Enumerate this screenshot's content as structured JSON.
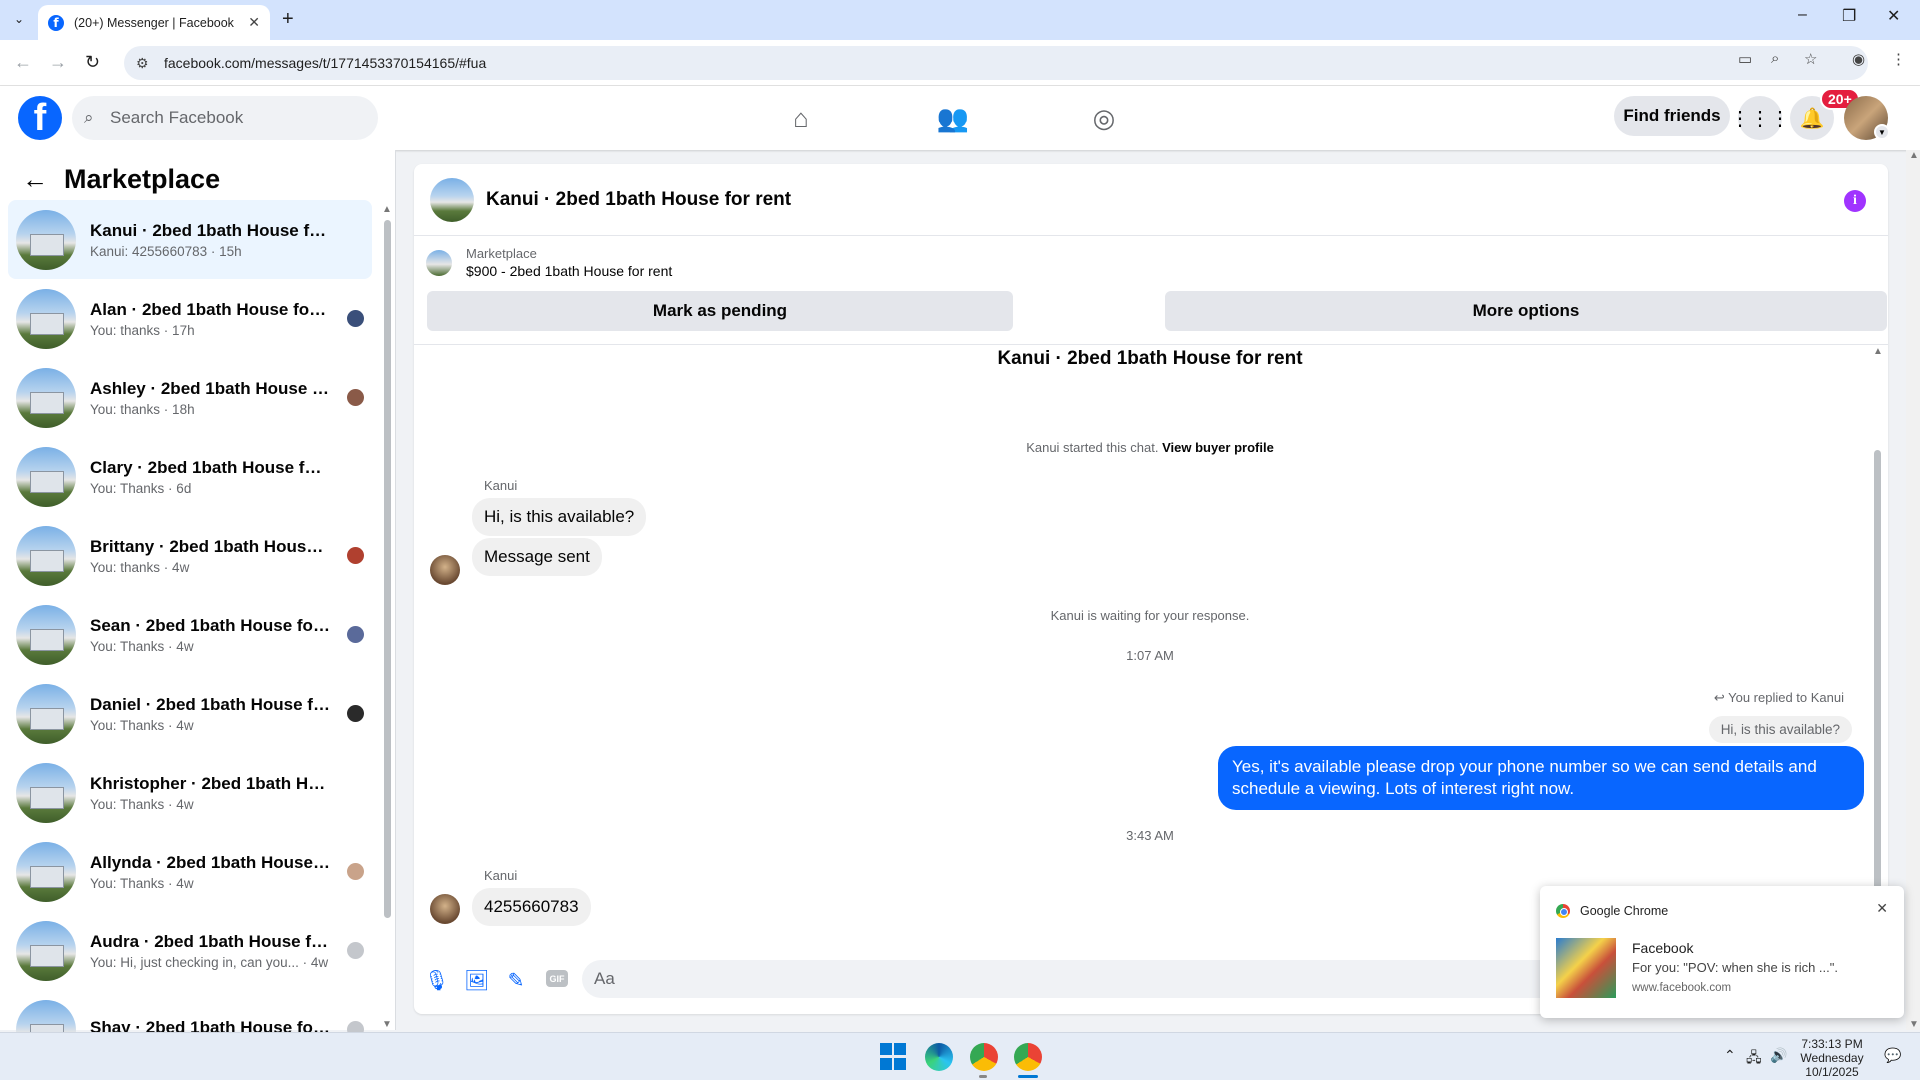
{
  "browser": {
    "tab_title": "(20+) Messenger | Facebook",
    "url": "facebook.com/messages/t/1771453370154165/#fua"
  },
  "header": {
    "search_placeholder": "Search Facebook",
    "find_friends": "Find friends",
    "notif_badge": "20+"
  },
  "sidebar": {
    "title": "Marketplace",
    "conversations": [
      {
        "name": "Kanui · 2bed 1bath House for rent",
        "preview": "Kanui: 4255660783 · 15h",
        "active": true,
        "mini": ""
      },
      {
        "name": "Alan · 2bed 1bath House for r...",
        "preview": "You: thanks · 17h",
        "mini": "#3a4f7a"
      },
      {
        "name": "Ashley · 2bed 1bath House for...",
        "preview": "You: thanks · 18h",
        "mini": "#8a5a48"
      },
      {
        "name": "Clary · 2bed 1bath House for rent",
        "preview": "You: Thanks · 6d",
        "mini": ""
      },
      {
        "name": "Brittany · 2bed 1bath House f...",
        "preview": "You: thanks · 4w",
        "mini": "#b0402f"
      },
      {
        "name": "Sean · 2bed 1bath House for r...",
        "preview": "You: Thanks · 4w",
        "mini": "#5a6a9a"
      },
      {
        "name": "Daniel · 2bed 1bath House for ...",
        "preview": "You: Thanks · 4w",
        "mini": "#2a2a2a"
      },
      {
        "name": "Khristopher · 2bed 1bath House ...",
        "preview": "You: Thanks · 4w",
        "mini": ""
      },
      {
        "name": "Allynda · 2bed 1bath House fo...",
        "preview": "You: Thanks · 4w",
        "mini": "#c9a38a"
      },
      {
        "name": "Audra · 2bed 1bath House for ...",
        "preview": "You: Hi, just checking in, can you... · 4w",
        "mini": "#c4c7cc"
      },
      {
        "name": "Shay · 2bed 1bath House for r...",
        "preview": "",
        "mini": "#c4c7cc"
      }
    ]
  },
  "chat": {
    "header_title": "Kanui · 2bed 1bath House for rent",
    "listing_source": "Marketplace",
    "listing_title": "$900 - 2bed 1bath House for rent",
    "mark_pending": "Mark as pending",
    "more_options": "More options",
    "conversation_title": "Kanui · 2bed 1bath House for rent",
    "started_text": "Kanui started this chat.",
    "view_buyer_profile": "View buyer profile",
    "sender_name": "Kanui",
    "msg1": "Hi, is this available?",
    "msg2": "Message sent",
    "waiting_text": "Kanui is waiting for your response.",
    "time1": "1:07 AM",
    "replied_to": "You replied to Kanui",
    "quoted": "Hi, is this available?",
    "reply": "Yes, it's available please drop your phone number so we can send details and schedule a viewing. Lots of interest right now.",
    "time2": "3:43 AM",
    "sender_name2": "Kanui",
    "msg3": "4255660783",
    "composer_placeholder": "Aa"
  },
  "notification": {
    "app": "Google Chrome",
    "title": "Facebook",
    "body": "For you: \"POV: when she is rich ...\".",
    "source": "www.facebook.com"
  },
  "taskbar": {
    "time": "7:33:13 PM",
    "day": "Wednesday",
    "date": "10/1/2025"
  }
}
